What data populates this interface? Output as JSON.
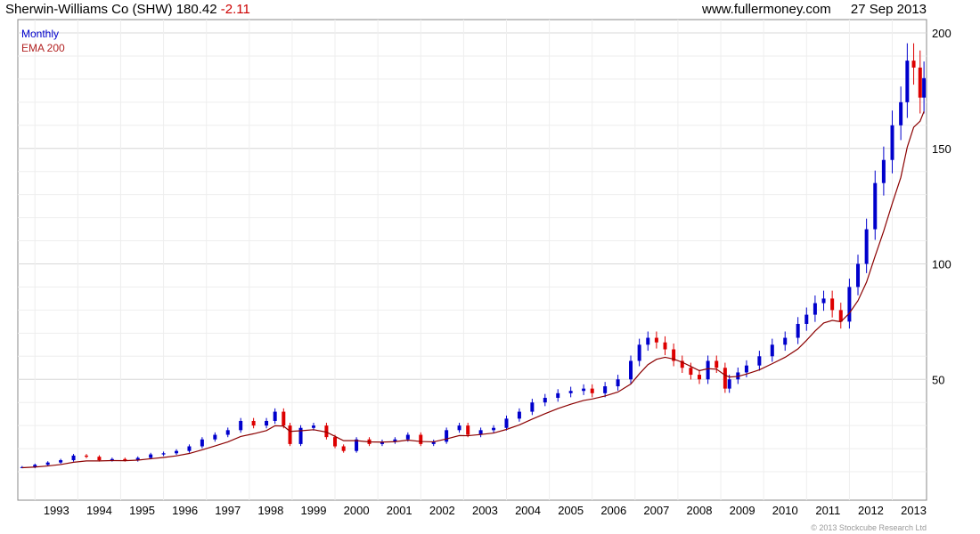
{
  "header": {
    "title": "Sherwin-Williams Co (SHW)",
    "last": "180.42",
    "change": "-2.11",
    "site": "www.fullermoney.com",
    "date": "27 Sep 2013"
  },
  "legend": {
    "period": "Monthly",
    "ema": "EMA 200"
  },
  "copyright": "© 2013 Stockcube Research Ltd",
  "colors": {
    "up": "#0000cc",
    "down": "#dd0000",
    "ema": "#8b0000",
    "grid": "#d9d9d9"
  },
  "chart_data": {
    "type": "candlestick",
    "period": "monthly",
    "ylim": [
      0,
      200
    ],
    "y_ticks": [
      50,
      100,
      150,
      200
    ],
    "x_ticks": [
      "1993",
      "1994",
      "1995",
      "1996",
      "1997",
      "1998",
      "1999",
      "2000",
      "2001",
      "2002",
      "2003",
      "2004",
      "2005",
      "2006",
      "2007",
      "2008",
      "2009",
      "2010",
      "2011",
      "2012",
      "2013"
    ],
    "x_range": [
      1992.6,
      2013.8
    ],
    "ema_label": "EMA 200",
    "series": [
      {
        "x": 1992.7,
        "c": 12
      },
      {
        "x": 1993.0,
        "c": 13
      },
      {
        "x": 1993.3,
        "c": 14
      },
      {
        "x": 1993.6,
        "c": 15
      },
      {
        "x": 1993.9,
        "c": 17
      },
      {
        "x": 1994.2,
        "c": 16.5
      },
      {
        "x": 1994.5,
        "c": 15
      },
      {
        "x": 1994.8,
        "c": 15.5
      },
      {
        "x": 1995.1,
        "c": 15
      },
      {
        "x": 1995.4,
        "c": 16
      },
      {
        "x": 1995.7,
        "c": 17.5
      },
      {
        "x": 1996.0,
        "c": 18
      },
      {
        "x": 1996.3,
        "c": 19
      },
      {
        "x": 1996.6,
        "c": 21
      },
      {
        "x": 1996.9,
        "c": 24
      },
      {
        "x": 1997.2,
        "c": 26
      },
      {
        "x": 1997.5,
        "c": 28
      },
      {
        "x": 1997.8,
        "c": 32
      },
      {
        "x": 1998.1,
        "c": 30
      },
      {
        "x": 1998.4,
        "c": 32
      },
      {
        "x": 1998.6,
        "c": 36
      },
      {
        "x": 1998.8,
        "c": 30
      },
      {
        "x": 1998.95,
        "c": 22
      },
      {
        "x": 1999.2,
        "c": 29
      },
      {
        "x": 1999.5,
        "c": 30
      },
      {
        "x": 1999.8,
        "c": 25
      },
      {
        "x": 2000.0,
        "c": 21
      },
      {
        "x": 2000.2,
        "c": 19
      },
      {
        "x": 2000.5,
        "c": 24
      },
      {
        "x": 2000.8,
        "c": 22
      },
      {
        "x": 2001.1,
        "c": 23
      },
      {
        "x": 2001.4,
        "c": 24
      },
      {
        "x": 2001.7,
        "c": 26
      },
      {
        "x": 2002.0,
        "c": 22
      },
      {
        "x": 2002.3,
        "c": 23
      },
      {
        "x": 2002.6,
        "c": 28
      },
      {
        "x": 2002.9,
        "c": 30
      },
      {
        "x": 2003.1,
        "c": 26
      },
      {
        "x": 2003.4,
        "c": 28
      },
      {
        "x": 2003.7,
        "c": 29
      },
      {
        "x": 2004.0,
        "c": 33
      },
      {
        "x": 2004.3,
        "c": 36
      },
      {
        "x": 2004.6,
        "c": 40
      },
      {
        "x": 2004.9,
        "c": 42
      },
      {
        "x": 2005.2,
        "c": 44
      },
      {
        "x": 2005.5,
        "c": 45
      },
      {
        "x": 2005.8,
        "c": 46
      },
      {
        "x": 2006.0,
        "c": 44
      },
      {
        "x": 2006.3,
        "c": 47
      },
      {
        "x": 2006.6,
        "c": 50
      },
      {
        "x": 2006.9,
        "c": 58
      },
      {
        "x": 2007.1,
        "c": 65
      },
      {
        "x": 2007.3,
        "c": 68
      },
      {
        "x": 2007.5,
        "c": 66
      },
      {
        "x": 2007.7,
        "c": 63
      },
      {
        "x": 2007.9,
        "c": 58
      },
      {
        "x": 2008.1,
        "c": 55
      },
      {
        "x": 2008.3,
        "c": 52
      },
      {
        "x": 2008.5,
        "c": 50
      },
      {
        "x": 2008.7,
        "c": 58
      },
      {
        "x": 2008.9,
        "c": 55
      },
      {
        "x": 2009.1,
        "c": 46
      },
      {
        "x": 2009.2,
        "c": 50
      },
      {
        "x": 2009.4,
        "c": 53
      },
      {
        "x": 2009.6,
        "c": 56
      },
      {
        "x": 2009.9,
        "c": 60
      },
      {
        "x": 2010.2,
        "c": 65
      },
      {
        "x": 2010.5,
        "c": 68
      },
      {
        "x": 2010.8,
        "c": 74
      },
      {
        "x": 2011.0,
        "c": 78
      },
      {
        "x": 2011.2,
        "c": 83
      },
      {
        "x": 2011.4,
        "c": 85
      },
      {
        "x": 2011.6,
        "c": 80
      },
      {
        "x": 2011.8,
        "c": 75
      },
      {
        "x": 2012.0,
        "c": 90
      },
      {
        "x": 2012.2,
        "c": 100
      },
      {
        "x": 2012.4,
        "c": 115
      },
      {
        "x": 2012.6,
        "c": 135
      },
      {
        "x": 2012.8,
        "c": 145
      },
      {
        "x": 2013.0,
        "c": 160
      },
      {
        "x": 2013.2,
        "c": 170
      },
      {
        "x": 2013.35,
        "c": 188
      },
      {
        "x": 2013.5,
        "c": 185
      },
      {
        "x": 2013.65,
        "c": 172
      },
      {
        "x": 2013.74,
        "c": 180.42
      }
    ]
  }
}
